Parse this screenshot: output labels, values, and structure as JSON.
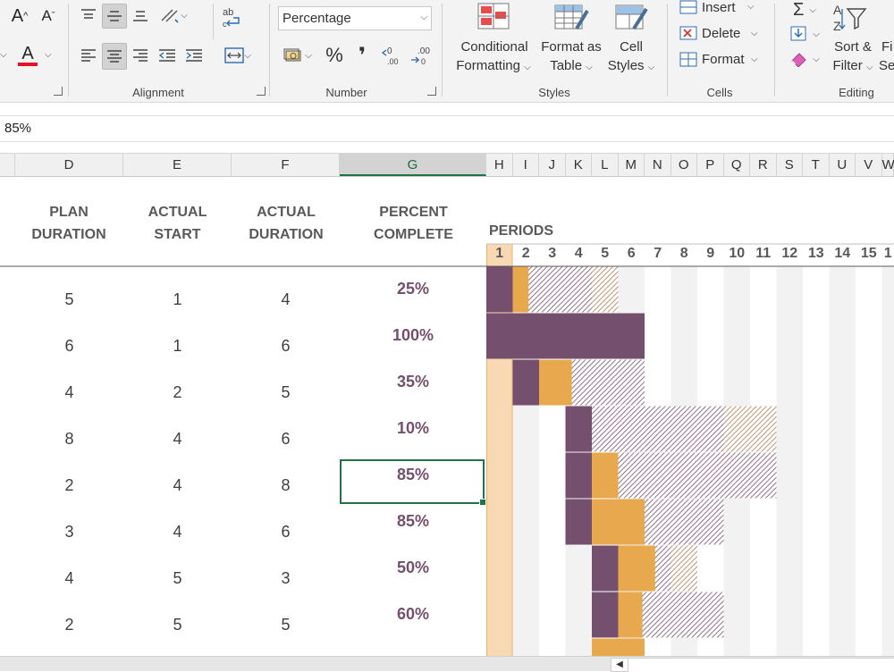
{
  "ribbon": {
    "number_format": "Percentage",
    "groups": {
      "alignment": "Alignment",
      "number": "Number",
      "styles": "Styles",
      "cells": "Cells",
      "editing": "Editing"
    },
    "styles": {
      "conditional_1": "Conditional",
      "conditional_2": "Formatting",
      "format_table_1": "Format as",
      "format_table_2": "Table",
      "cell_styles_1": "Cell",
      "cell_styles_2": "Styles"
    },
    "cells": {
      "insert": "Insert",
      "delete": "Delete",
      "format": "Format"
    },
    "editing": {
      "sort_1": "Sort &",
      "sort_2": "Filter",
      "find_1": "Fi",
      "find_2": "Se"
    },
    "percent_symbol": "%",
    "comma_symbol": "❜",
    "colors": {
      "font_color_bar": "#e81123",
      "accent": "#217346"
    }
  },
  "formula_bar": {
    "value": "85%"
  },
  "columns": [
    "D",
    "E",
    "F",
    "G",
    "H",
    "I",
    "J",
    "K",
    "L",
    "M",
    "N",
    "O",
    "P",
    "Q",
    "R",
    "S",
    "T",
    "U",
    "V",
    "W"
  ],
  "headers": {
    "plan_duration": [
      "PLAN",
      "DURATION"
    ],
    "actual_start": [
      "ACTUAL",
      "START"
    ],
    "actual_duration": [
      "ACTUAL",
      "DURATION"
    ],
    "percent_complete": [
      "PERCENT",
      "COMPLETE"
    ],
    "periods": "PERIODS"
  },
  "period_numbers": [
    "1",
    "2",
    "3",
    "4",
    "5",
    "6",
    "7",
    "8",
    "9",
    "10",
    "11",
    "12",
    "13",
    "14",
    "15",
    "1"
  ],
  "rows": [
    {
      "plan_start": 1,
      "plan_duration": "5",
      "actual_start": "1",
      "actual_duration": "4",
      "percent": "25%",
      "percent_value": 25
    },
    {
      "plan_start": 1,
      "plan_duration": "6",
      "actual_start": "1",
      "actual_duration": "6",
      "percent": "100%",
      "percent_value": 100
    },
    {
      "plan_start": 2,
      "plan_duration": "4",
      "actual_start": "2",
      "actual_duration": "5",
      "percent": "35%",
      "percent_value": 35
    },
    {
      "plan_start": 4,
      "plan_duration": "8",
      "actual_start": "4",
      "actual_duration": "6",
      "percent": "10%",
      "percent_value": 10
    },
    {
      "plan_start": 4,
      "plan_duration": "2",
      "actual_start": "4",
      "actual_duration": "8",
      "percent": "85%",
      "percent_value": 85
    },
    {
      "plan_start": 4,
      "plan_duration": "3",
      "actual_start": "4",
      "actual_duration": "6",
      "percent": "85%",
      "percent_value": 85
    },
    {
      "plan_start": 5,
      "plan_duration": "4",
      "actual_start": "5",
      "actual_duration": "3",
      "percent": "50%",
      "percent_value": 50
    },
    {
      "plan_start": 5,
      "plan_duration": "2",
      "actual_start": "5",
      "actual_duration": "5",
      "percent": "60%",
      "percent_value": 60
    },
    {
      "plan_start": 5,
      "plan_duration": "",
      "actual_start": "",
      "actual_duration": "",
      "percent": "",
      "percent_value": null
    }
  ],
  "selected_cell": {
    "column": "G",
    "row_index": 4
  },
  "gantt_colors": {
    "plan": "#75506e",
    "actual": "#e8a94e",
    "period_highlight": "#f8d9b4",
    "stripe_even": "#f2f2f2",
    "stripe_odd": "#ffffff"
  }
}
